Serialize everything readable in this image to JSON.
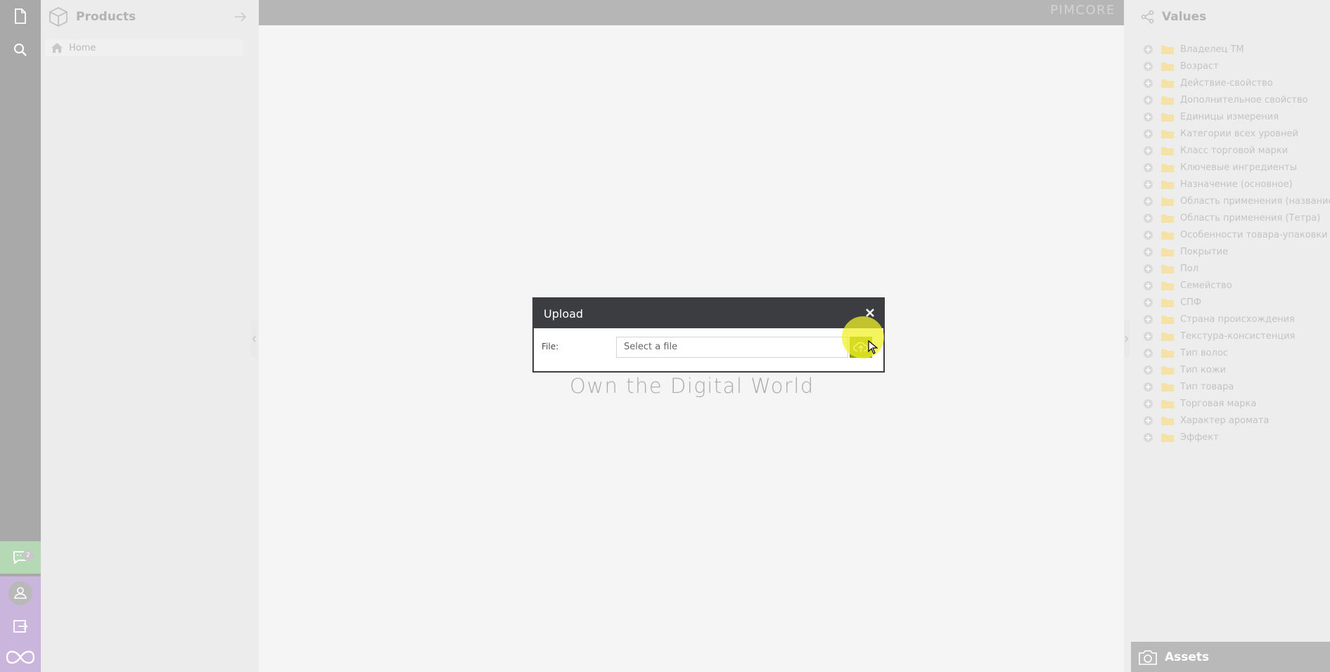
{
  "left_toolbar": {
    "notifications_count": "2"
  },
  "tree_panel": {
    "title": "Products",
    "home_label": "Home"
  },
  "header": {
    "logo_text": "PIMCORE"
  },
  "splash": {
    "tagline": "Own the Digital World"
  },
  "values_panel": {
    "title": "Values",
    "items": [
      "Владелец ТМ",
      "Возраст",
      "Действие-свойство",
      "Дополнительное свойство",
      "Единицы измерения",
      "Категории всех уровней",
      "Класс торговой марки",
      "Ключевые ингредиенты",
      "Назначение (основное)",
      "Область применения (название)",
      "Область применения (Тетра)",
      "Особенности товара-упаковки",
      "Покрытие",
      "Пол",
      "Семейство",
      "СПФ",
      "Страна происхождения",
      "Текстура-консистенция",
      "Тип волос",
      "Тип кожи",
      "Тип товара",
      "Торговая марка",
      "Характер аромата",
      "Эффект"
    ]
  },
  "assets_panel": {
    "title": "Assets"
  },
  "upload_dialog": {
    "title": "Upload",
    "file_label": "File:",
    "file_placeholder": "Select a file"
  },
  "colors": {
    "dialog_header": "#3b3d40",
    "upload_button": "#8a9a12",
    "cursor_highlight": "#f0f028"
  }
}
